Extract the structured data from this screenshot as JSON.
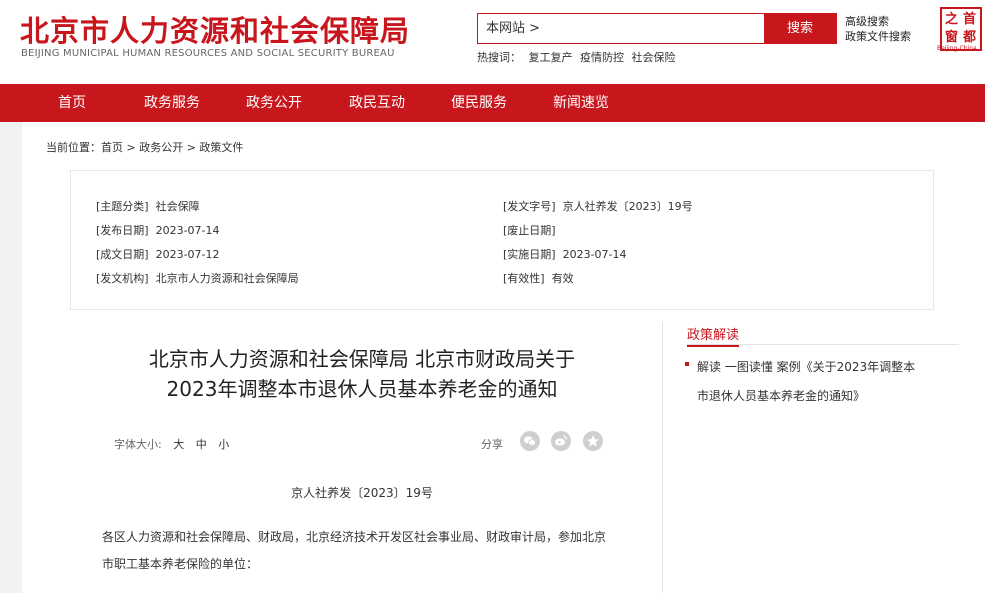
{
  "site": {
    "title_cn": "北京市人力资源和社会保障局",
    "title_en": "BEIJING MUNICIPAL HUMAN RESOURCES AND SOCIAL SECURITY BUREAU"
  },
  "search": {
    "scope": "本网站 >",
    "button": "搜索",
    "advanced": "高级搜索",
    "policy_search": "政策文件搜索",
    "hot_label": "热搜词：",
    "hot_words": [
      "复工复产",
      "疫情防控",
      "社会保险"
    ]
  },
  "stamp": {
    "chars": [
      "之",
      "首",
      "窗",
      "都"
    ],
    "sub": "Beijing-China"
  },
  "nav": [
    "首页",
    "政务服务",
    "政务公开",
    "政民互动",
    "便民服务",
    "新闻速览"
  ],
  "breadcrumb": "当前位置：首页 > 政务公开 > 政策文件",
  "meta": {
    "left": [
      {
        "label": "[主题分类]",
        "value": "社会保障"
      },
      {
        "label": "[发布日期]",
        "value": "2023-07-14"
      },
      {
        "label": "[成文日期]",
        "value": "2023-07-12"
      },
      {
        "label": "[发文机构]",
        "value": "北京市人力资源和社会保障局"
      }
    ],
    "right": [
      {
        "label": "[发文字号]",
        "value": "京人社养发〔2023〕19号"
      },
      {
        "label": "[废止日期]",
        "value": ""
      },
      {
        "label": "[实施日期]",
        "value": "2023-07-14"
      },
      {
        "label": "[有效性]",
        "value": "有效"
      }
    ]
  },
  "article": {
    "title_line1": "北京市人力资源和社会保障局 北京市财政局关于",
    "title_line2": "2023年调整本市退休人员基本养老金的通知",
    "font_size_label": "字体大小:",
    "font_sizes": [
      "大",
      "中",
      "小"
    ],
    "share_label": "分享",
    "share_icons": [
      "wechat-icon",
      "weibo-icon",
      "favorite-icon"
    ],
    "doc_no": "京人社养发〔2023〕19号",
    "body": "各区人力资源和社会保障局、财政局，北京经济技术开发区社会事业局、财政审计局，参加北京市职工基本养老保险的单位："
  },
  "sidebar": {
    "heading": "政策解读",
    "item": "解读 一图读懂 案例《关于2023年调整本市退休人员基本养老金的通知》"
  },
  "colors": {
    "brand": "#c8161d",
    "background": "#f2f2f2"
  }
}
